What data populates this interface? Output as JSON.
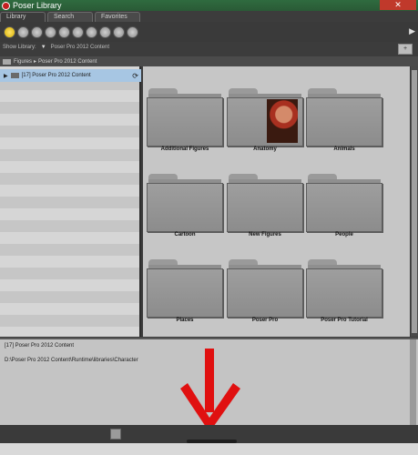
{
  "window": {
    "title": "Poser Library",
    "close_glyph": "✕"
  },
  "tabs": [
    {
      "label": "Library"
    },
    {
      "label": "Search"
    },
    {
      "label": "Favorites"
    }
  ],
  "toolbar": {
    "category_buttons": [
      "figures",
      "poses",
      "expressions",
      "hair",
      "hands",
      "props",
      "lights",
      "cameras",
      "materials",
      "scenes"
    ],
    "more_icon": "chevron-right"
  },
  "show_library": {
    "label": "Show Library:",
    "value": "Poser Pro 2012 Content"
  },
  "breadcrumb": {
    "root": "Figures",
    "separator": "▸",
    "current": "Poser Pro 2012 Content"
  },
  "tree": {
    "item_label": "[17]  Poser Pro 2012 Content"
  },
  "folders": [
    {
      "label": "Additional Figures"
    },
    {
      "label": "Anatomy"
    },
    {
      "label": "Animals"
    },
    {
      "label": "Cartoon"
    },
    {
      "label": "New Figures"
    },
    {
      "label": "People"
    },
    {
      "label": "Places"
    },
    {
      "label": "Poser Pro"
    },
    {
      "label": "Poser Pro Tutorial"
    }
  ],
  "info": {
    "line1": "[17]  Poser Pro 2012 Content",
    "line2": "D:\\Poser Pro 2012 Content\\Runtime\\libraries\\Character"
  },
  "colors": {
    "accent_yellow": "#e8c400",
    "selection": "#a7c6e3",
    "annotation_red": "#e01010"
  }
}
